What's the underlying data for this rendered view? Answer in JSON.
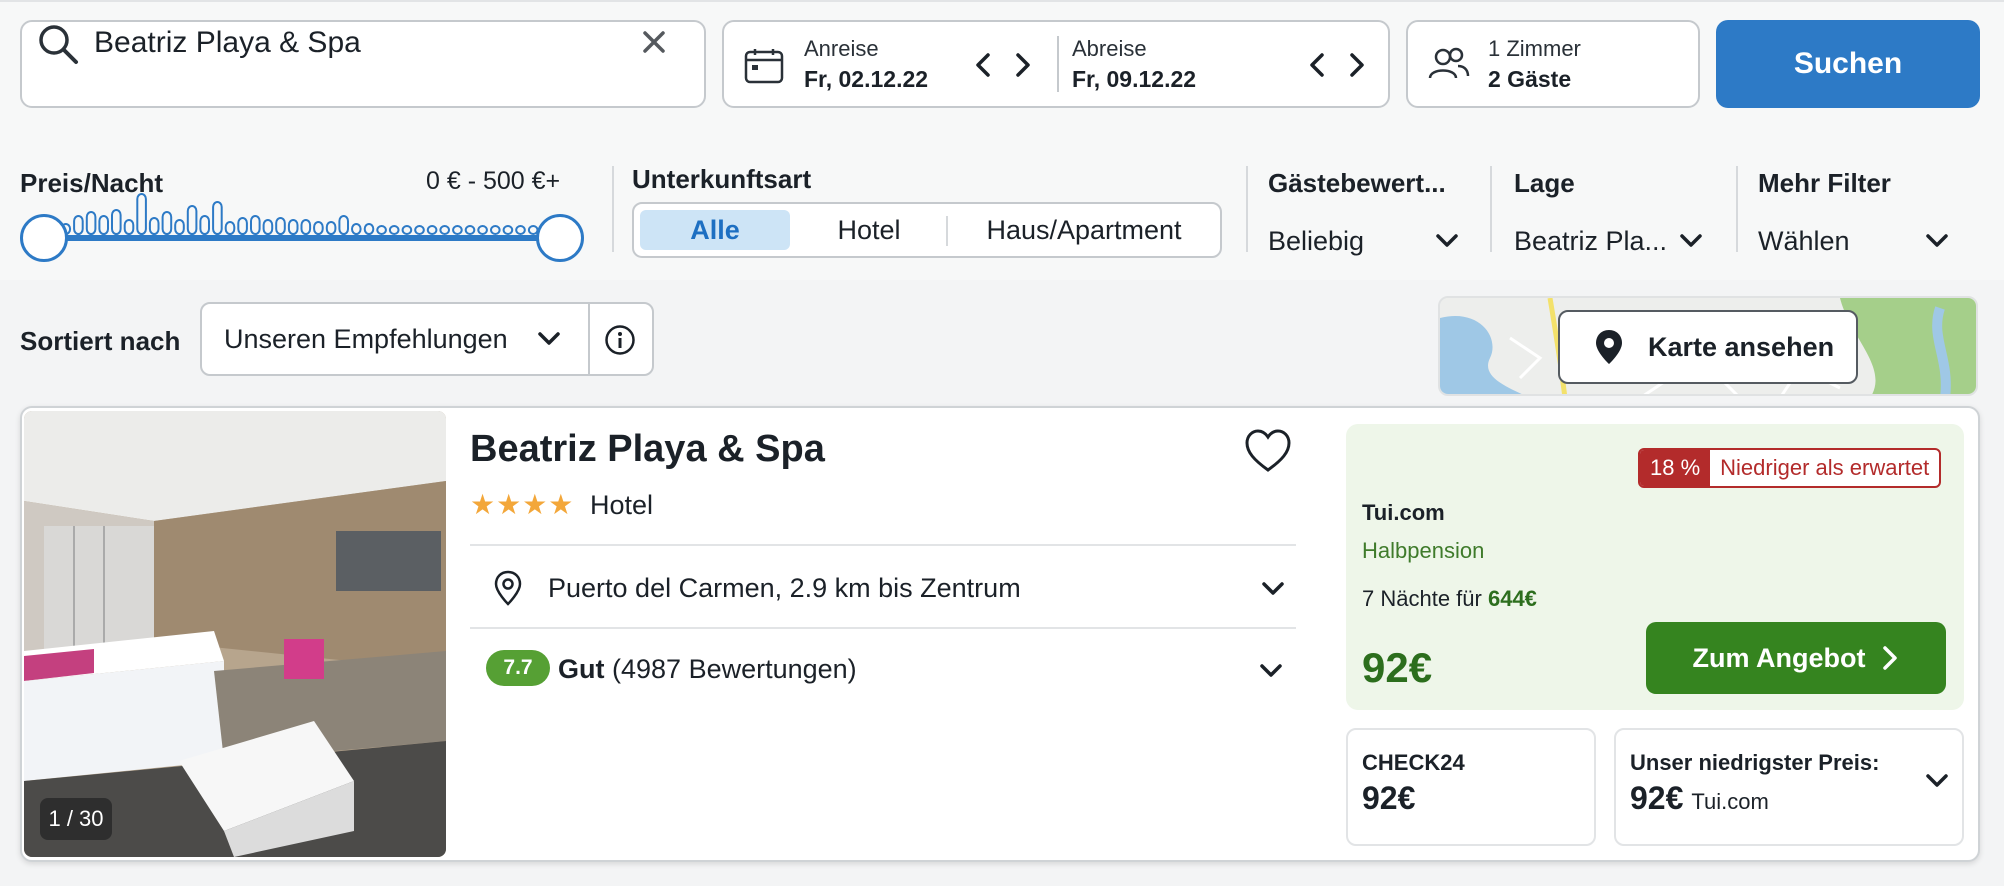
{
  "search": {
    "query": "Beatriz Playa & Spa"
  },
  "dates": {
    "checkin_label": "Anreise",
    "checkin_value": "Fr, 02.12.22",
    "checkout_label": "Abreise",
    "checkout_value": "Fr, 09.12.22"
  },
  "guests": {
    "rooms": "1 Zimmer",
    "guests": "2 Gäste"
  },
  "search_button": "Suchen",
  "filters": {
    "price_label": "Preis/Nacht",
    "price_range": "0 € - 500 €+",
    "type_label": "Unterkunftsart",
    "type_options": [
      "Alle",
      "Hotel",
      "Haus/Apartment"
    ],
    "rating_label": "Gästebewert...",
    "rating_value": "Beliebig",
    "location_label": "Lage",
    "location_value": "Beatriz Pla...",
    "more_label": "Mehr Filter",
    "more_value": "Wählen"
  },
  "sort": {
    "label": "Sortiert nach",
    "value": "Unseren Empfehlungen"
  },
  "map": {
    "button": "Karte ansehen"
  },
  "hotel": {
    "name": "Beatriz Playa & Spa",
    "stars": "★★★★",
    "type": "Hotel",
    "location": "Puerto del Carmen, 2.9 km bis Zentrum",
    "rating_score": "7.7",
    "rating_word": "Gut",
    "rating_count": "(4987 Bewertungen)",
    "photo_counter": "1 / 30"
  },
  "offer": {
    "deal_pct": "18 %",
    "deal_text": "Niedriger als erwartet",
    "provider": "Tui.com",
    "board": "Halbpension",
    "nights_text": "7 Nächte für",
    "nights_total": "644€",
    "price": "92€",
    "button": "Zum Angebot"
  },
  "alt_prices": {
    "check24_label": "CHECK24",
    "check24_price": "92€",
    "lowest_label": "Unser niedrigster Preis:",
    "lowest_price": "92€",
    "lowest_provider": "Tui.com"
  },
  "colors": {
    "primary_blue": "#2d7ac6",
    "offer_green": "#35841f",
    "deal_red": "#b32b2b",
    "star": "#f3a73a"
  }
}
